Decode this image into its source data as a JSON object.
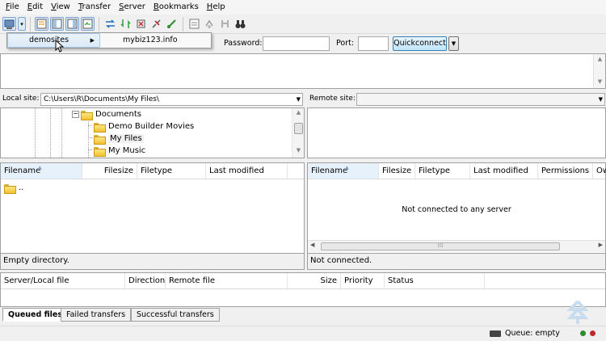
{
  "menu": [
    "File",
    "Edit",
    "View",
    "Transfer",
    "Server",
    "Bookmarks",
    "Help"
  ],
  "menu_accels": [
    "F",
    "E",
    "V",
    "T",
    "S",
    "B",
    "H"
  ],
  "site_menu": {
    "item": "demosites",
    "submenu_item": "mybiz123.info"
  },
  "quickconnect": {
    "password_label": "Password:",
    "port_label": "Port:",
    "button_label": "Quickconnect",
    "password_value": "",
    "port_value": ""
  },
  "local": {
    "site_label": "Local site:",
    "site_path": "C:\\Users\\R\\Documents\\My Files\\",
    "tree": [
      {
        "label": "Documents"
      },
      {
        "label": "Demo Builder Movies"
      },
      {
        "label": "My Files"
      },
      {
        "label": "My Music"
      }
    ],
    "columns": [
      "Filename",
      "Filesize",
      "Filetype",
      "Last modified"
    ],
    "rows": [
      {
        "name": ".."
      }
    ],
    "status": "Empty directory."
  },
  "remote": {
    "site_label": "Remote site:",
    "site_path": "",
    "columns": [
      "Filename",
      "Filesize",
      "Filetype",
      "Last modified",
      "Permissions",
      "Ow"
    ],
    "empty_message": "Not connected to any server",
    "status": "Not connected."
  },
  "queue": {
    "columns": [
      "Server/Local file",
      "Direction",
      "Remote file",
      "Size",
      "Priority",
      "Status"
    ],
    "tabs": [
      "Queued files",
      "Failed transfers",
      "Successful transfers"
    ],
    "active_tab": 0
  },
  "statusbar": {
    "queue_text": "Queue: empty"
  },
  "colors": {
    "accent": "#3c7fb1",
    "folder": "#f2c230",
    "led_green": "#2e8b2e",
    "led_red": "#c0282d"
  }
}
